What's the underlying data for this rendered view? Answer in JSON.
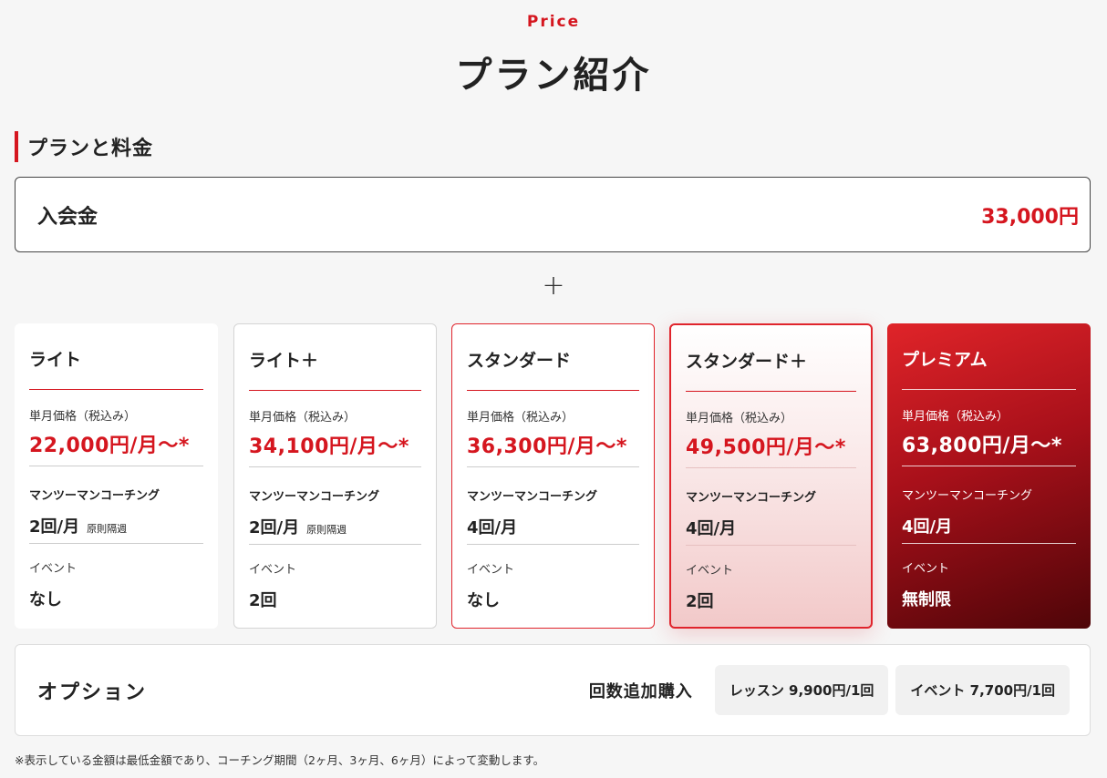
{
  "header": {
    "eyebrow": "Price",
    "title": "プラン紹介"
  },
  "section": {
    "heading": "プランと料金"
  },
  "enrollment": {
    "label": "入会金",
    "price": "33,000円"
  },
  "plus_symbol": "+",
  "plans": [
    {
      "name": "ライト",
      "price_label": "単月価格（税込み）",
      "price": "22,000円/月〜*",
      "coaching_label": "マンツーマンコーチング",
      "coaching_value": "2回/月",
      "coaching_note": "原則隔週",
      "event_label": "イベント",
      "event_value": "なし"
    },
    {
      "name": "ライト＋",
      "price_label": "単月価格（税込み）",
      "price": "34,100円/月〜*",
      "coaching_label": "マンツーマンコーチング",
      "coaching_value": "2回/月",
      "coaching_note": "原則隔週",
      "event_label": "イベント",
      "event_value": "2回"
    },
    {
      "name": "スタンダード",
      "price_label": "単月価格（税込み）",
      "price": "36,300円/月〜*",
      "coaching_label": "マンツーマンコーチング",
      "coaching_value": "4回/月",
      "coaching_note": "",
      "event_label": "イベント",
      "event_value": "なし"
    },
    {
      "name": "スタンダード＋",
      "price_label": "単月価格（税込み）",
      "price": "49,500円/月〜*",
      "coaching_label": "マンツーマンコーチング",
      "coaching_value": "4回/月",
      "coaching_note": "",
      "event_label": "イベント",
      "event_value": "2回"
    },
    {
      "name": "プレミアム",
      "price_label": "単月価格（税込み）",
      "price": "63,800円/月〜*",
      "coaching_label": "マンツーマンコーチング",
      "coaching_value": "4回/月",
      "coaching_note": "",
      "event_label": "イベント",
      "event_value": "無制限"
    }
  ],
  "options": {
    "title": "オプション",
    "subtitle": "回数追加購入",
    "items": [
      "レッスン 9,900円/1回",
      "イベント 7,700円/1回"
    ]
  },
  "footnote": "※表示している金額は最低金額であり、コーチング期間（2ヶ月、3ヶ月、6ヶ月）によって変動します。",
  "colors": {
    "accent": "#d5161f",
    "background": "#f6f6f6",
    "premium_gradient_start": "#e02429",
    "premium_gradient_end": "#4e0508"
  }
}
